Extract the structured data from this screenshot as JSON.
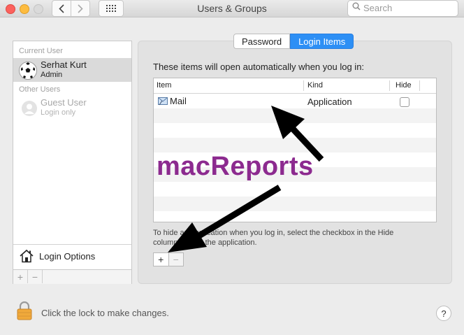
{
  "window": {
    "title": "Users & Groups"
  },
  "toolbar": {
    "back_icon": "chevron-left-icon",
    "forward_icon": "chevron-right-icon",
    "grid_icon": "show-all-grid-icon",
    "search_placeholder": "Search"
  },
  "sidebar": {
    "current_user_label": "Current User",
    "current_user": {
      "name": "Serhat Kurt",
      "role": "Admin"
    },
    "other_users_label": "Other Users",
    "other_user": {
      "name": "Guest User",
      "role": "Login only"
    },
    "login_options_label": "Login Options",
    "add_symbol": "+",
    "remove_symbol": "−"
  },
  "tabs": {
    "password": "Password",
    "login_items": "Login Items",
    "selected": "Login Items"
  },
  "main": {
    "intro": "These items will open automatically when you log in:",
    "columns": {
      "item": "Item",
      "kind": "Kind",
      "hide": "Hide"
    },
    "rows": [
      {
        "item": "Mail",
        "kind": "Application",
        "hide": false
      }
    ],
    "hint_line1": "To hide an application when you log in, select the checkbox in the Hide",
    "hint_line2": "column next to the application.",
    "add_symbol": "+",
    "remove_symbol": "−"
  },
  "overlay": {
    "watermark": "macReports"
  },
  "footer": {
    "lock_text": "Click the lock to make changes.",
    "help_symbol": "?"
  },
  "colors": {
    "accent": "#2d8ff5",
    "watermark": "#8c2a8f",
    "close": "#fc615d",
    "minimize": "#fdbc40"
  }
}
